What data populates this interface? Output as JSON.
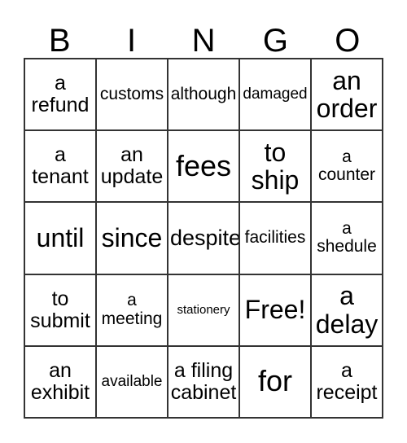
{
  "card": {
    "title": "BINGO",
    "header_letters": [
      "B",
      "I",
      "N",
      "G",
      "O"
    ],
    "columns": 5,
    "rows": 5,
    "free_space_label": "Free!",
    "colors": {
      "border": "#333333",
      "text": "#000000",
      "background": "#ffffff"
    },
    "cells": [
      [
        {
          "text": "a\nrefund",
          "size": "sz-m"
        },
        {
          "text": "customs",
          "size": "sz-sm"
        },
        {
          "text": "although",
          "size": "sz-sm"
        },
        {
          "text": "damaged",
          "size": "sz-s"
        },
        {
          "text": "an\norder",
          "size": "sz-l"
        }
      ],
      [
        {
          "text": "a\ntenant",
          "size": "sz-m"
        },
        {
          "text": "an\nupdate",
          "size": "sz-m"
        },
        {
          "text": "fees",
          "size": "sz-xl"
        },
        {
          "text": "to\nship",
          "size": "sz-l"
        },
        {
          "text": "a\ncounter",
          "size": "sz-sm"
        }
      ],
      [
        {
          "text": "until",
          "size": "sz-l"
        },
        {
          "text": "since",
          "size": "sz-l"
        },
        {
          "text": "despite",
          "size": "sz-ml"
        },
        {
          "text": "facilities",
          "size": "sz-sm"
        },
        {
          "text": "a\nshedule",
          "size": "sz-sm"
        }
      ],
      [
        {
          "text": "to\nsubmit",
          "size": "sz-m"
        },
        {
          "text": "a\nmeeting",
          "size": "sz-sm"
        },
        {
          "text": "stationery",
          "size": "sz-xs"
        },
        {
          "text": "Free!",
          "size": "sz-l"
        },
        {
          "text": "a\ndelay",
          "size": "sz-l"
        }
      ],
      [
        {
          "text": "an\nexhibit",
          "size": "sz-m"
        },
        {
          "text": "available",
          "size": "sz-s"
        },
        {
          "text": "a filing\ncabinet",
          "size": "sz-m"
        },
        {
          "text": "for",
          "size": "sz-xl"
        },
        {
          "text": "a\nreceipt",
          "size": "sz-m"
        }
      ]
    ]
  }
}
